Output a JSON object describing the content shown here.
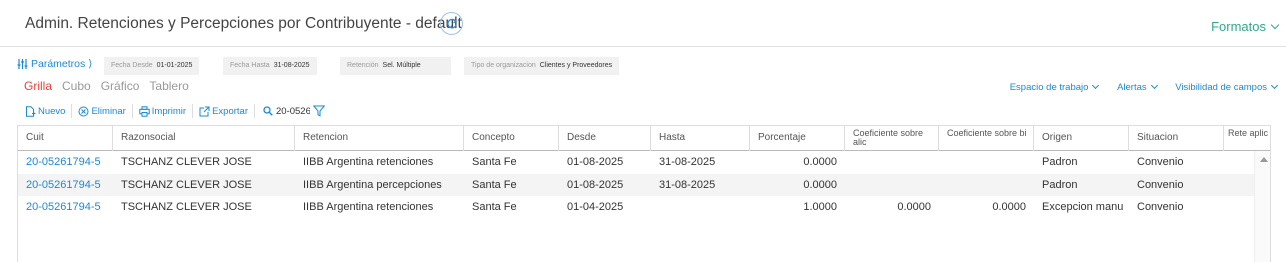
{
  "header": {
    "title": "Admin. Retenciones y Percepciones por Contribuyente - default",
    "formatos_label": "Formatos"
  },
  "params": {
    "label": "Parámetros",
    "filters": [
      {
        "label": "Fecha Desde",
        "value": "01-01-2025"
      },
      {
        "label": "Fecha Hasta",
        "value": "31-08-2025"
      },
      {
        "label": "Retención",
        "value": "Sel. Múltiple"
      },
      {
        "label": "Tipo de organizacion",
        "value": "Clientes y Proveedores"
      }
    ]
  },
  "view_tabs": [
    {
      "label": "Grilla",
      "active": true
    },
    {
      "label": "Cubo",
      "active": false
    },
    {
      "label": "Gráfico",
      "active": false
    },
    {
      "label": "Tablero",
      "active": false
    }
  ],
  "right_links": [
    "Espacio de trabajo",
    "Alertas",
    "Visibilidad de campos"
  ],
  "toolbar": {
    "new_label": "Nuevo",
    "delete_label": "Eliminar",
    "print_label": "Imprimir",
    "export_label": "Exportar",
    "search_value": "20-0526"
  },
  "grid": {
    "columns": [
      "Cuit",
      "Razonsocial",
      "Retencion",
      "Concepto",
      "Desde",
      "Hasta",
      "Porcentaje",
      "Coeficiente sobre alic",
      "Coeficiente sobre bi",
      "Origen",
      "Situacion",
      "Rete aplic"
    ],
    "rows": [
      [
        "20-05261794-5",
        "TSCHANZ CLEVER JOSE",
        "IIBB Argentina retenciones",
        "Santa Fe",
        "01-08-2025",
        "31-08-2025",
        "0.0000",
        "",
        "",
        "Padron",
        "Convenio",
        ""
      ],
      [
        "20-05261794-5",
        "TSCHANZ CLEVER JOSE",
        "IIBB Argentina percepciones",
        "Santa Fe",
        "01-08-2025",
        "31-08-2025",
        "0.0000",
        "",
        "",
        "Padron",
        "Convenio",
        ""
      ],
      [
        "20-05261794-5",
        "TSCHANZ CLEVER JOSE",
        "IIBB Argentina retenciones",
        "Santa Fe",
        "01-04-2025",
        "",
        "1.0000",
        "0.0000",
        "0.0000",
        "Excepcion manu",
        "Convenio",
        ""
      ]
    ]
  }
}
